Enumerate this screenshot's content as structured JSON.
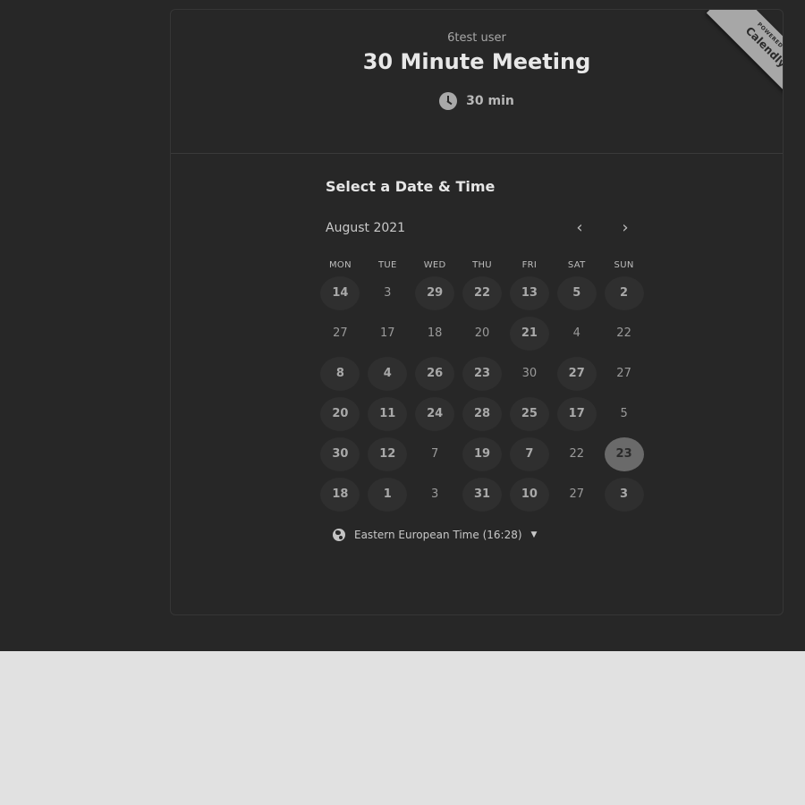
{
  "header": {
    "owner": "6test user",
    "title": "30 Minute Meeting",
    "duration": "30 min"
  },
  "badge": {
    "powered_by": "POWERED BY",
    "brand": "Calendly"
  },
  "calendar": {
    "section_title": "Select a Date & Time",
    "month": "August 2021",
    "prev_icon": "chevron-left-icon",
    "next_icon": "chevron-right-icon",
    "weekdays": [
      "MON",
      "TUE",
      "WED",
      "THU",
      "FRI",
      "SAT",
      "SUN"
    ],
    "days": [
      {
        "label": "14",
        "state": "available"
      },
      {
        "label": "3",
        "state": "unavailable"
      },
      {
        "label": "29",
        "state": "available"
      },
      {
        "label": "22",
        "state": "available"
      },
      {
        "label": "13",
        "state": "available"
      },
      {
        "label": "5",
        "state": "available"
      },
      {
        "label": "2",
        "state": "available"
      },
      {
        "label": "27",
        "state": "unavailable"
      },
      {
        "label": "17",
        "state": "unavailable"
      },
      {
        "label": "18",
        "state": "unavailable"
      },
      {
        "label": "20",
        "state": "unavailable"
      },
      {
        "label": "21",
        "state": "available"
      },
      {
        "label": "4",
        "state": "unavailable"
      },
      {
        "label": "22",
        "state": "unavailable"
      },
      {
        "label": "8",
        "state": "available"
      },
      {
        "label": "4",
        "state": "available"
      },
      {
        "label": "26",
        "state": "available"
      },
      {
        "label": "23",
        "state": "available"
      },
      {
        "label": "30",
        "state": "unavailable"
      },
      {
        "label": "27",
        "state": "available"
      },
      {
        "label": "27",
        "state": "unavailable"
      },
      {
        "label": "20",
        "state": "available"
      },
      {
        "label": "11",
        "state": "available"
      },
      {
        "label": "24",
        "state": "available"
      },
      {
        "label": "28",
        "state": "available"
      },
      {
        "label": "25",
        "state": "available"
      },
      {
        "label": "17",
        "state": "available"
      },
      {
        "label": "5",
        "state": "unavailable"
      },
      {
        "label": "30",
        "state": "available"
      },
      {
        "label": "12",
        "state": "available"
      },
      {
        "label": "7",
        "state": "unavailable"
      },
      {
        "label": "19",
        "state": "available"
      },
      {
        "label": "7",
        "state": "available"
      },
      {
        "label": "22",
        "state": "unavailable"
      },
      {
        "label": "23",
        "state": "selected"
      },
      {
        "label": "18",
        "state": "available"
      },
      {
        "label": "1",
        "state": "available"
      },
      {
        "label": "3",
        "state": "unavailable"
      },
      {
        "label": "31",
        "state": "available"
      },
      {
        "label": "10",
        "state": "available"
      },
      {
        "label": "27",
        "state": "unavailable"
      },
      {
        "label": "3",
        "state": "available"
      }
    ]
  },
  "timezone": {
    "label": "Eastern European Time (16:28)",
    "icon": "globe-icon"
  }
}
